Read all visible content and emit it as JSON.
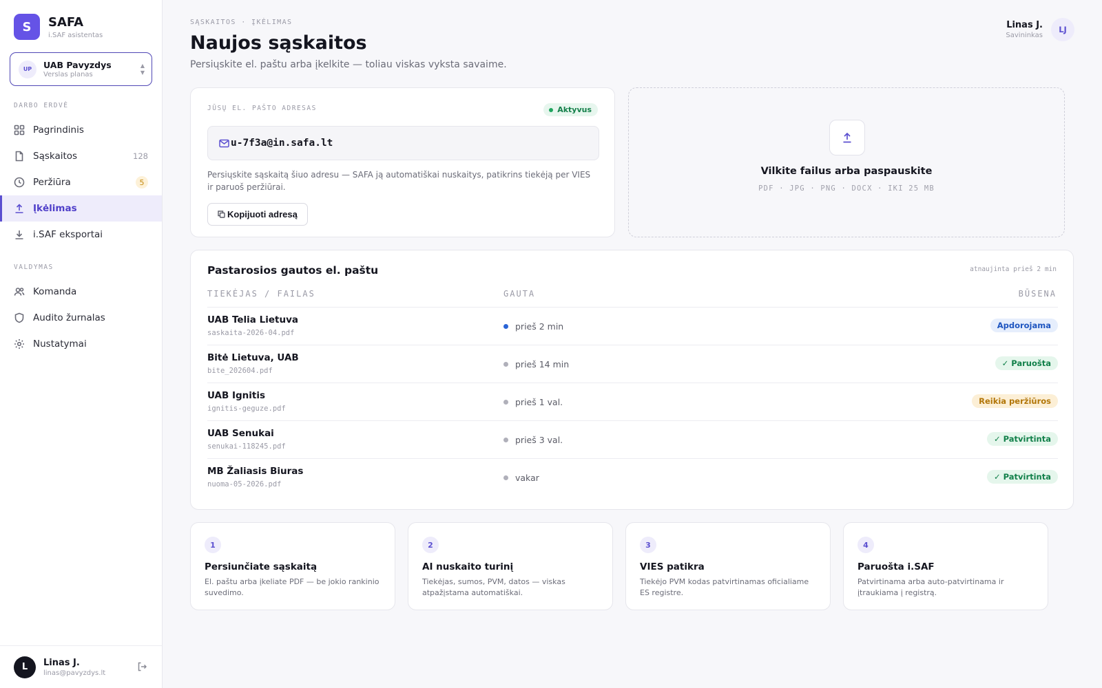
{
  "brand": {
    "logo_letter": "S",
    "name": "SAFA",
    "subtitle": "i.SAF asistentas",
    "accent": "#6553e6"
  },
  "org": {
    "initials": "UP",
    "name": "UAB Pavyzdys",
    "plan": "Verslas planas",
    "chevron_up": "▲",
    "chevron_down": "▼"
  },
  "sidebar": {
    "workspace_label": "DARBO ERDVĖ",
    "workspace_items": [
      {
        "label": "Pagrindinis",
        "icon": "grid-icon"
      },
      {
        "label": "Sąskaitos",
        "icon": "document-icon",
        "count": "128"
      },
      {
        "label": "Peržiūra",
        "icon": "clock-icon",
        "badge": "5"
      },
      {
        "label": "Įkėlimas",
        "icon": "upload-icon",
        "active": true
      },
      {
        "label": "i.SAF eksportai",
        "icon": "download-icon"
      }
    ],
    "manage_label": "VALDYMAS",
    "manage_items": [
      {
        "label": "Komanda",
        "icon": "users-icon"
      },
      {
        "label": "Audito žurnalas",
        "icon": "shield-icon"
      },
      {
        "label": "Nustatymai",
        "icon": "gear-icon"
      }
    ]
  },
  "user": {
    "initial": "L",
    "name": "Linas J.",
    "email": "linas@pavyzdys.lt",
    "initials": "LJ",
    "role": "Savininkas"
  },
  "header": {
    "breadcrumb": "SĄSKAITOS · ĮKĖLIMAS",
    "title": "Naujos sąskaitos",
    "subtitle": "Persiųskite el. paštu arba įkelkite — toliau viskas vyksta savaime."
  },
  "email_card": {
    "label": "JŪSŲ EL. PAŠTO ADRESAS",
    "status": "Aktyvus",
    "address": "u-7f3a@in.safa.lt",
    "description": "Persiųskite sąskaitą šiuo adresu — SAFA ją automatiškai nuskaitys, patikrins tiekėją per VIES ir paruoš peržiūrai.",
    "copy_label": "Kopijuoti adresą"
  },
  "dropzone": {
    "title": "Vilkite failus arba paspauskite",
    "formats": "PDF · JPG · PNG · DOCX · IKI 25 MB"
  },
  "recent": {
    "title": "Pastarosios gautos el. paštu",
    "updated": "atnaujinta prieš 2 min",
    "columns": {
      "supplier": "TIEKĖJAS / FAILAS",
      "received": "GAUTA",
      "status": "BŪSENA"
    },
    "rows": [
      {
        "supplier": "UAB Telia Lietuva",
        "file": "saskaita-2026-04.pdf",
        "received": "prieš 2 min",
        "status": "Apdorojama",
        "tone": "blue",
        "live": true
      },
      {
        "supplier": "Bitė Lietuva, UAB",
        "file": "bite_202604.pdf",
        "received": "prieš 14 min",
        "status": "✓ Paruošta",
        "tone": "green"
      },
      {
        "supplier": "UAB Ignitis",
        "file": "ignitis-geguze.pdf",
        "received": "prieš 1 val.",
        "status": "Reikia peržiūros",
        "tone": "amber"
      },
      {
        "supplier": "UAB Senukai",
        "file": "senukai-118245.pdf",
        "received": "prieš 3 val.",
        "status": "✓ Patvirtinta",
        "tone": "green"
      },
      {
        "supplier": "MB Žaliasis Biuras",
        "file": "nuoma-05-2026.pdf",
        "received": "vakar",
        "status": "✓ Patvirtinta",
        "tone": "green"
      }
    ]
  },
  "steps": [
    {
      "num": "1",
      "title": "Persiunčiate sąskaitą",
      "desc": "El. paštu arba įkeliate PDF — be jokio rankinio suvedimo."
    },
    {
      "num": "2",
      "title": "AI nuskaito turinį",
      "desc": "Tiekėjas, sumos, PVM, datos — viskas atpažįstama automatiškai."
    },
    {
      "num": "3",
      "title": "VIES patikra",
      "desc": "Tiekėjo PVM kodas patvirtinamas oficialiame ES registre."
    },
    {
      "num": "4",
      "title": "Paruošta i.SAF",
      "desc": "Patvirtinama arba auto-patvirtinama ir įtraukiama į registrą."
    }
  ]
}
